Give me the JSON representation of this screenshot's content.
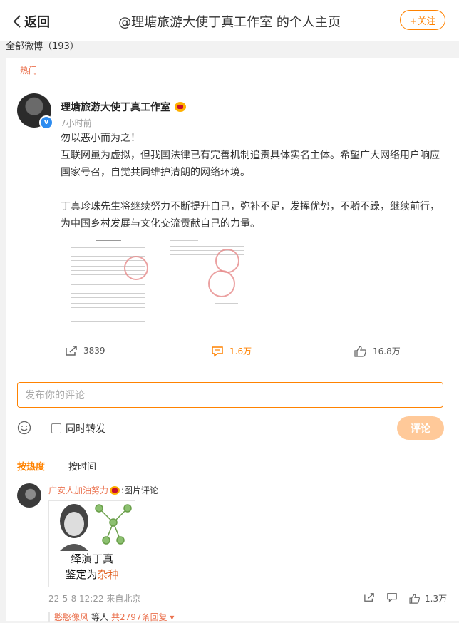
{
  "header": {
    "back_label": "返回",
    "title": "@理塘旅游大使丁真工作室 的个人主页",
    "follow_label": "+关注"
  },
  "tabs": {
    "all_posts_label": "全部微博（193）"
  },
  "post": {
    "section_tag": "热门",
    "author": "理塘旅游大使丁真工作室",
    "time": "7小时前",
    "paragraphs": [
      "勿以恶小而为之！",
      "互联网虽为虚拟，但我国法律已有完善机制追责具体实名主体。希望广大网络用户响应国家号召，自觉共同维护清朗的网络环境。",
      "丁真珍珠先生将继续努力不断提升自己，弥补不足，发挥优势，不骄不躁，继续前行，为中国乡村发展与文化交流贡献自己的力量。"
    ],
    "reposts": "3839",
    "comments": "1.6万",
    "likes": "16.8万"
  },
  "comment_form": {
    "placeholder": "发布你的评论",
    "repost_label": "同时转发",
    "submit_label": "评论"
  },
  "sort": {
    "hot_label": "按热度",
    "time_label": "按时间"
  },
  "comments": [
    {
      "user": "广安人加油努力",
      "label": ":图片评论",
      "image_caption_line1": "绎演丁真",
      "image_caption_line2_prefix": "鉴定为",
      "image_caption_line2_highlight": "杂种",
      "meta": "22-5-8 12:22 来自北京",
      "likes": "1.3万",
      "reply_user": "憨憨像风",
      "reply_etc": "等人",
      "reply_count": "共2797条回复 ▾"
    }
  ],
  "colors": {
    "accent": "#ff8200",
    "username": "#eb7350",
    "verified": "#2d8cf0"
  }
}
